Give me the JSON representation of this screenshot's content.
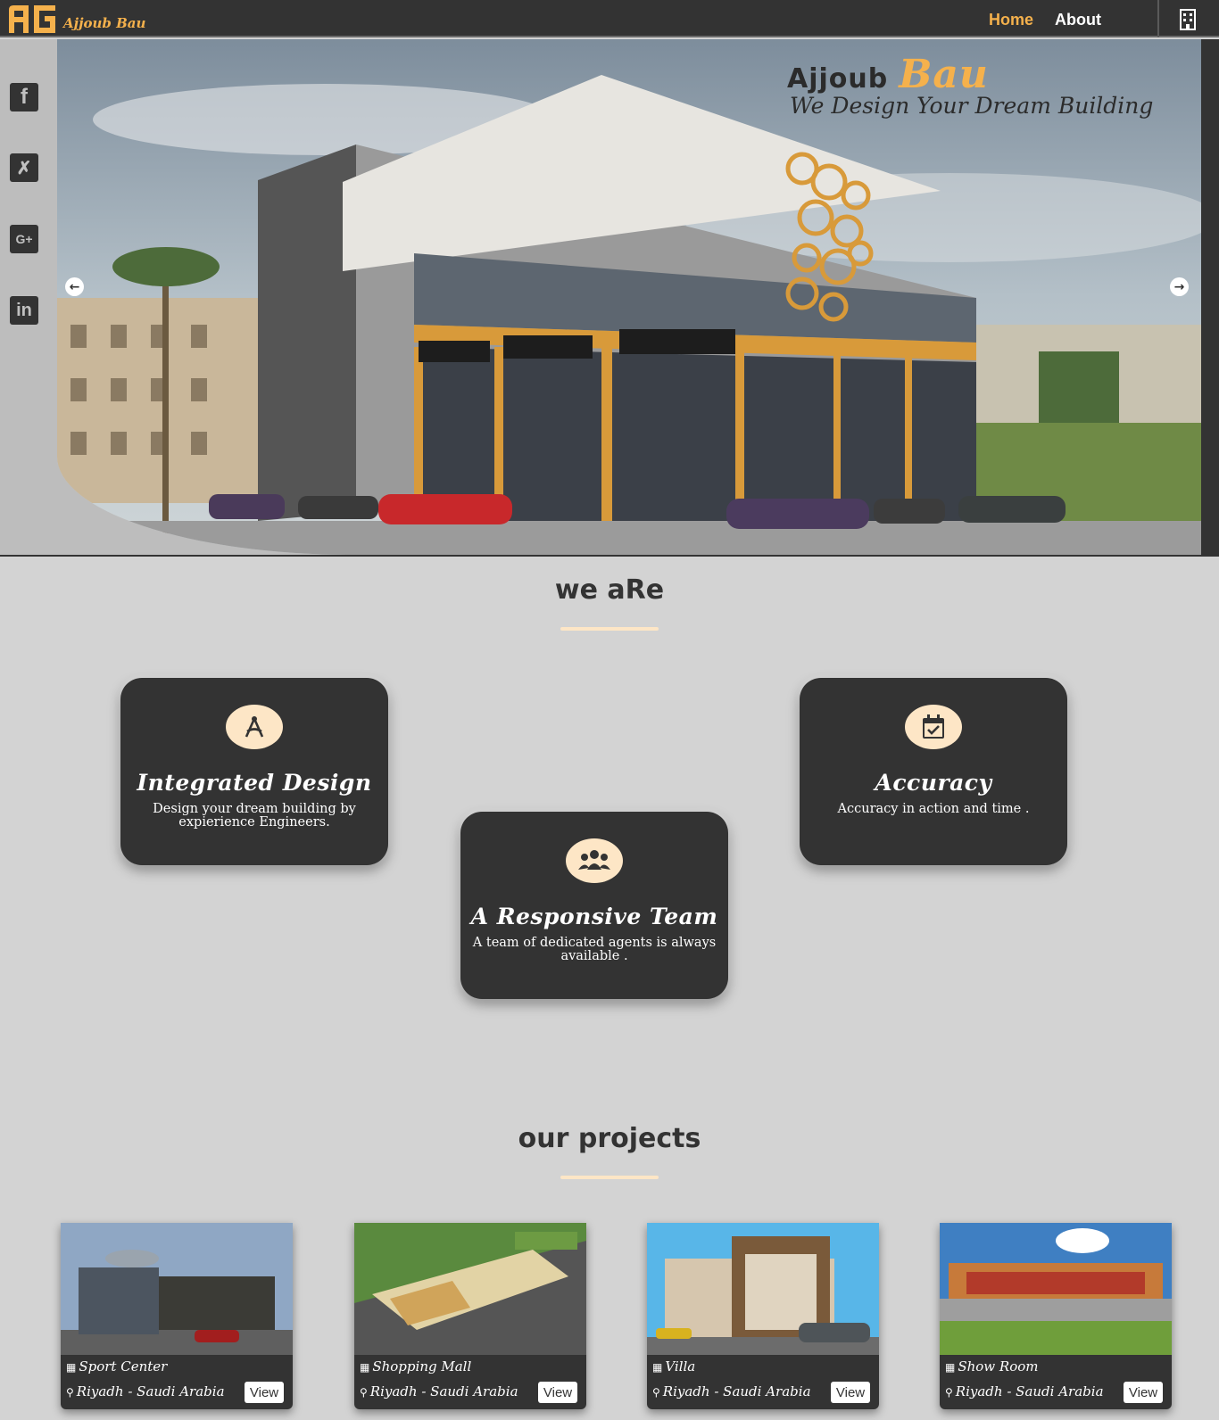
{
  "navbar": {
    "logo_text": "Ajjoub Bau",
    "links": [
      {
        "label": "Home"
      },
      {
        "label": "About"
      }
    ],
    "building_icon": "building-icon",
    "accent_color": "#f5b14c"
  },
  "social": [
    {
      "icon": "facebook-icon",
      "glyph": "f"
    },
    {
      "icon": "xing-icon",
      "glyph": "✗"
    },
    {
      "icon": "google-plus-icon",
      "glyph": "G+"
    },
    {
      "icon": "linkedin-icon",
      "glyph": "in"
    }
  ],
  "hero": {
    "brand_main": "Ajjoub",
    "brand_accent": "Bau",
    "slogan": "We Design Your Dream Building",
    "prev_icon": "arrow-left-icon",
    "next_icon": "arrow-right-icon"
  },
  "we_are": {
    "title": "we aRe",
    "cards": [
      {
        "icon": "compass-drafting-icon",
        "title": "Integrated Design",
        "text": "Design your dream building by expierience Engineers."
      },
      {
        "icon": "users-icon",
        "title": "A Responsive Team",
        "text": "A team of dedicated agents is always available ."
      },
      {
        "icon": "calendar-check-icon",
        "title": "Accuracy",
        "text": "Accuracy in action and time ."
      }
    ]
  },
  "projects": {
    "title": "our projects",
    "items": [
      {
        "name": "Sport Center",
        "location": "Riyadh - Saudi Arabia",
        "button": "View"
      },
      {
        "name": "Shopping Mall",
        "location": "Riyadh - Saudi Arabia",
        "button": "View"
      },
      {
        "name": "Villa",
        "location": "Riyadh - Saudi Arabia",
        "button": "View"
      },
      {
        "name": "Show Room",
        "location": "Riyadh - Saudi Arabia",
        "button": "View"
      }
    ]
  }
}
